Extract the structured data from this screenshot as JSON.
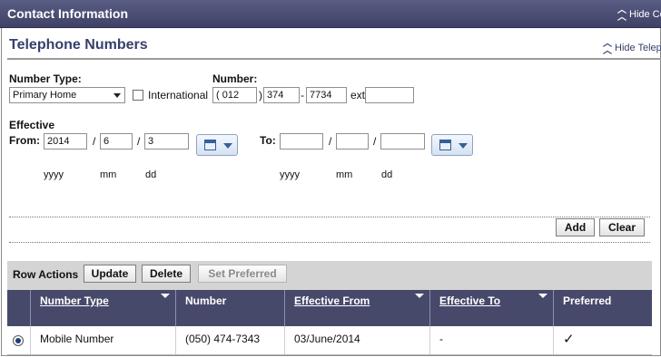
{
  "header": {
    "title": "Contact Information",
    "hide_label": "Hide Co"
  },
  "section": {
    "title": "Telephone Numbers",
    "hide_label": "Hide Telep"
  },
  "form": {
    "number_type_label": "Number Type:",
    "number_type_value": "Primary Home",
    "international_label": "International",
    "international_checked": false,
    "number_label": "Number:",
    "area_open": "(",
    "area_code": "012",
    "area_close": ")",
    "prefix": "374",
    "dash": "-",
    "line": "7734",
    "ext_label": "ext",
    "ext_value": "",
    "effective_label": "Effective",
    "from_label": "From:",
    "from_year": "2014",
    "from_month": "6",
    "from_day": "3",
    "to_label": "To:",
    "to_year": "",
    "to_month": "",
    "to_day": "",
    "slash": "/",
    "hint_yyyy": "yyyy",
    "hint_mm": "mm",
    "hint_dd": "dd",
    "add_button": "Add",
    "clear_button": "Clear"
  },
  "row_actions": {
    "label": "Row Actions",
    "update_button": "Update",
    "delete_button": "Delete",
    "set_preferred_button": "Set Preferred"
  },
  "table": {
    "columns": [
      "Number Type",
      "Number",
      "Effective From",
      "Effective To",
      "Preferred"
    ],
    "rows": [
      {
        "selected": true,
        "number_type": "Mobile Number",
        "number": "(050) 474-7343",
        "effective_from": "03/June/2014",
        "effective_to": "-",
        "preferred": "✓"
      }
    ]
  },
  "colors": {
    "header_bar": "#3f4166",
    "section_title": "#37406b",
    "table_header": "#47496b"
  }
}
